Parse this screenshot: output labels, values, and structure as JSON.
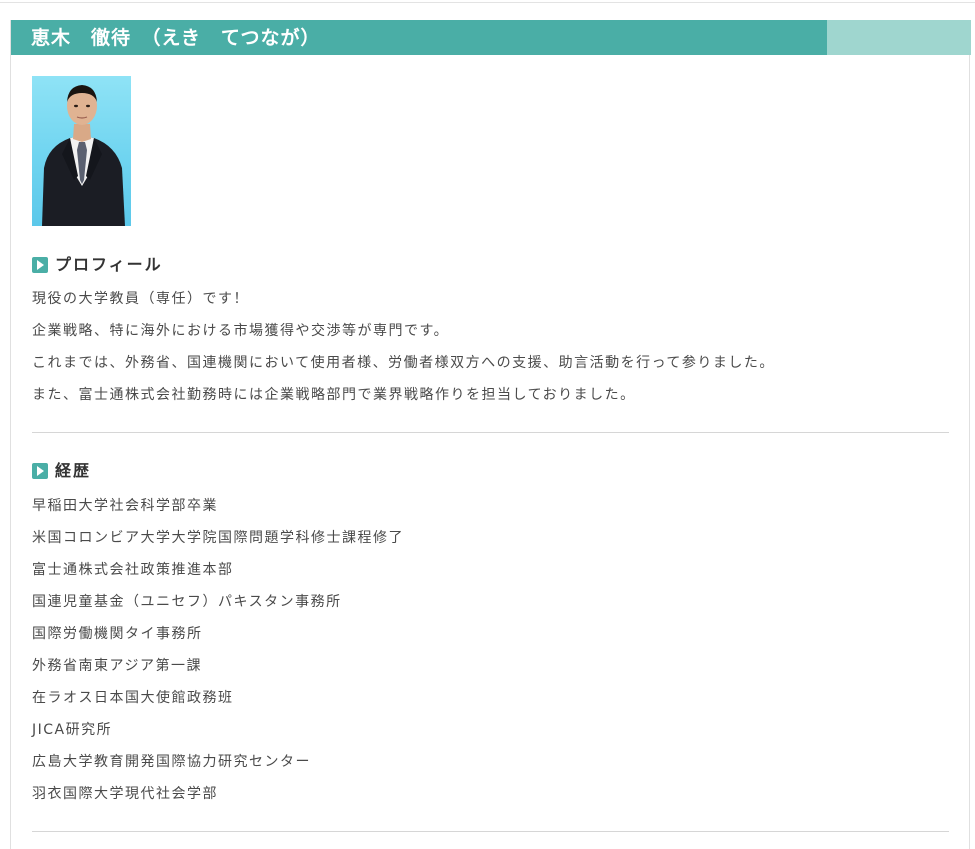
{
  "header": {
    "name": "恵木　徹待　（えき　てつなが）"
  },
  "profile": {
    "heading": "プロフィール",
    "lines": [
      "現役の大学教員（専任）です！",
      "企業戦略、特に海外における市場獲得や交渉等が専門です。",
      "これまでは、外務省、国連機関において使用者様、労働者様双方への支援、助言活動を行って参りました。",
      "また、富士通株式会社勤務時には企業戦略部門で業界戦略作りを担当しておりました。"
    ]
  },
  "career": {
    "heading": "経歴",
    "lines": [
      "早稲田大学社会科学部卒業",
      "米国コロンビア大学大学院国際問題学科修士課程修了",
      "富士通株式会社政策推進本部",
      "国連児童基金（ユニセフ）パキスタン事務所",
      "国際労働機関タイ事務所",
      "外務省南東アジア第一課",
      "在ラオス日本国大使館政務班",
      "JICA研究所",
      "広島大学教育開発国際協力研究センター",
      "羽衣国際大学現代社会学部"
    ]
  },
  "colors": {
    "accent": "#4aaea6",
    "accent_light": "#9fd6cf",
    "photo_bg": "#7ad9f2"
  }
}
